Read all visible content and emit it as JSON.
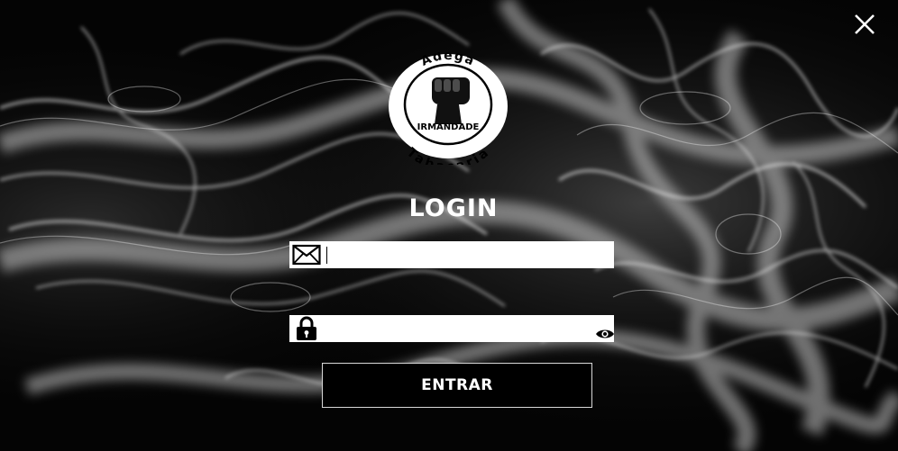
{
  "window": {
    "background_color": "#000000"
  },
  "close_icon": "close-icon",
  "logo": {
    "top_text": "Adega",
    "middle_text": "IRMANDADE",
    "bottom_text": "Tabacaria",
    "icon": "raised-fist-icon"
  },
  "login": {
    "title": "LOGIN",
    "email_icon": "envelope-icon",
    "email_value": "",
    "password_icon": "lock-icon",
    "password_value": "",
    "show_password_icon": "eye-icon",
    "submit_label": "ENTRAR"
  }
}
